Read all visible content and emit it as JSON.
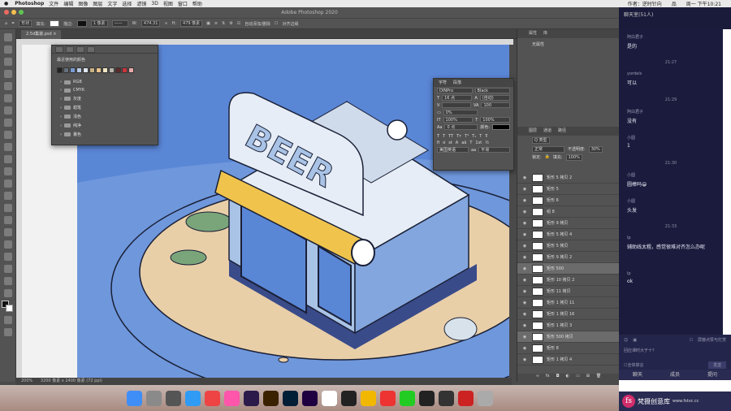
{
  "menubar": {
    "app": "Photoshop",
    "menus": [
      "文件",
      "编辑",
      "图像",
      "图层",
      "文字",
      "选择",
      "滤镜",
      "3D",
      "视图",
      "窗口",
      "帮助"
    ],
    "right_text": "作者：逆时针向",
    "time": "周一 下午10:21",
    "ime": "品"
  },
  "window": {
    "title": "Adobe Photoshop 2020"
  },
  "options": {
    "tool_mode": "形状",
    "fill_label": "填充:",
    "stroke_label": "描边:",
    "stroke_size": "1 像素",
    "w_label": "W:",
    "w_value": "474.31",
    "h_label": "H:",
    "h_value": "479 像素",
    "auto_add": "自动添加/删除",
    "align_edges": "对齐边缘"
  },
  "document": {
    "tab": "2.5d集装.psd",
    "status": "200%",
    "doc_size": "3200 像素 x 2400 像素 (72 ppi)"
  },
  "color_panel": {
    "title": "最近使用的颜色",
    "folders": [
      "RGB",
      "CMYK",
      "灰度",
      "蜡笔",
      "浅色",
      "纯净",
      "暑色"
    ],
    "swatches": [
      "#222222",
      "#666f7c",
      "#7a9bd4",
      "#b9cbe4",
      "#dfe6ef",
      "#c9b184",
      "#e8c48e",
      "#f3e6c4",
      "#b8b3ab",
      "#5b2a2a",
      "#c8343c",
      "#e8a9a9"
    ]
  },
  "char_panel": {
    "tabs": [
      "字符",
      "段落"
    ],
    "font": "DINPro",
    "style": "Black",
    "size": "16 点",
    "leading": "(自动)",
    "tracking": "100",
    "kerning": "0%",
    "vscale": "100%",
    "hscale": "100%",
    "baseline": "0 点",
    "color_label": "颜色:",
    "language": "美国英语",
    "aa": "平滑"
  },
  "right_panel": {
    "tabs": [
      "属性",
      "库"
    ],
    "props_label": "无属性",
    "layer_tabs": [
      "图层",
      "通道",
      "路径"
    ],
    "kind": "Q 类型",
    "blend": "正常",
    "opacity_label": "不透明度:",
    "opacity": "30%",
    "lock_label": "锁定:",
    "fill_label": "填充:",
    "fill": "100%",
    "layers": [
      "矩形 5 拷贝 2",
      "矩形 5",
      "矩形 6",
      "组 8",
      "矩形 9 拷贝",
      "矩形 5 拷贝 4",
      "矩形 5 拷贝",
      "矩形 9 拷贝 2",
      "矩形 500",
      "矩形 10 拷贝 2",
      "矩形 11 拷贝",
      "矩形 1 拷贝 11",
      "矩形 1 拷贝 16",
      "矩形 1 拷贝 3",
      "矩形 500 拷贝",
      "矩形 8",
      "矩形 1 拷贝 4"
    ]
  },
  "chat": {
    "title": "聊天室(51人)",
    "tabs": [
      "聊天",
      "成员",
      "提问"
    ],
    "input_placeholder": "回应课时大于十？",
    "announce": "屏蔽点赞与打赏",
    "all": "全体禁言",
    "send": "发送",
    "messages": [
      {
        "name": "阿白君子",
        "text": "是的",
        "time": "21:27"
      },
      {
        "name": "yordels",
        "text": "可以",
        "time": "21:29"
      },
      {
        "name": "阿白君子",
        "text": "没有",
        "time": ""
      },
      {
        "name": "小圆",
        "text": "1",
        "time": "21:30"
      },
      {
        "name": "小圆",
        "text": "圆棒吗😁",
        "time": ""
      },
      {
        "name": "小圆",
        "text": "头发",
        "time": "21:33"
      },
      {
        "name": "lp",
        "text": "辅助线太粗，感觉很难对齐怎么办呢",
        "time": ""
      },
      {
        "name": "lp",
        "text": "ok",
        "time": ""
      }
    ]
  },
  "canvas": {
    "sign_text": "BEER",
    "colors": {
      "sky": "#5a86d6",
      "ground": "#e9cfa8",
      "grass": "#7aa57a",
      "wall": "#a9c3e6",
      "roof": "#e6edf6",
      "dark": "#1a2036"
    }
  },
  "dock": {
    "apps": [
      "finder",
      "launchpad",
      "rocket",
      "safari",
      "chrome",
      "photos",
      "pr",
      "ai",
      "ps",
      "ae",
      "calendar",
      "figma",
      "sketch",
      "weibo",
      "wechat",
      "qq",
      "obs",
      "video",
      "trash"
    ]
  },
  "watermark": {
    "logo": "fs",
    "name": "梵摄创意库",
    "url": "www.fstvc.cc"
  }
}
